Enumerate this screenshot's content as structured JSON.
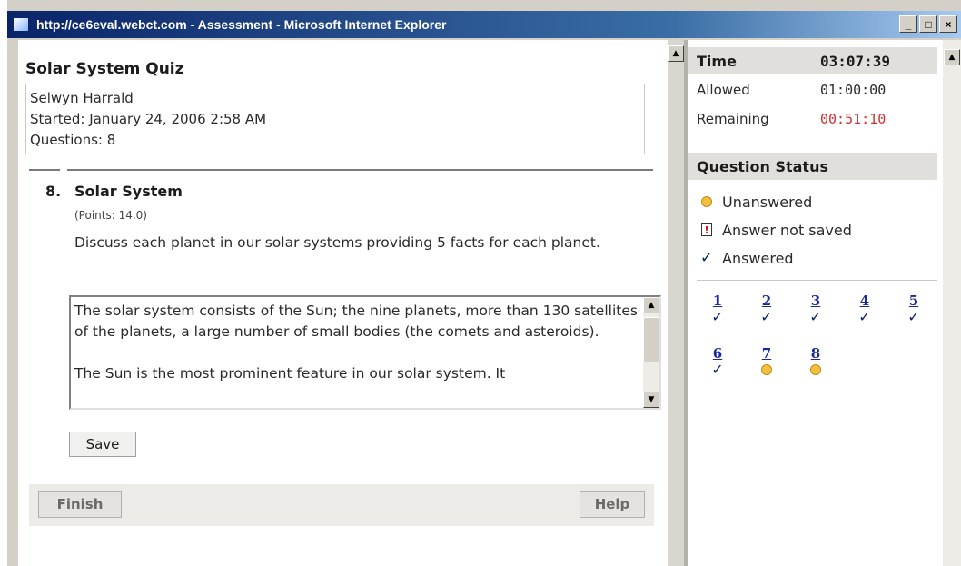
{
  "window": {
    "title": "http://ce6eval.webct.com - Assessment - Microsoft Internet Explorer",
    "buttons": {
      "minimize": "_",
      "maximize": "□",
      "close": "×"
    }
  },
  "quiz": {
    "title": "Solar System Quiz",
    "student": "Selwyn Harrald",
    "started": "Started: January 24, 2006 2:58 AM",
    "questions": "Questions: 8"
  },
  "question": {
    "number": "8.",
    "title": "Solar System",
    "points": "(Points: 14.0)",
    "text": "Discuss each planet in our solar systems providing 5 facts for each planet.",
    "answer": "The solar system consists of the Sun; the nine planets, more than 130 satellites of the planets, a large number of small bodies (the comets and asteroids).\n\nThe Sun is the most prominent feature in our solar system. It"
  },
  "actions": {
    "save": "Save",
    "finish": "Finish",
    "help": "Help"
  },
  "timer": {
    "label": "Time",
    "value": "03:07:39",
    "allowed_label": "Allowed",
    "allowed_value": "01:00:00",
    "remaining_label": "Remaining",
    "remaining_value": "00:51:10"
  },
  "status": {
    "header": "Question Status",
    "legend": {
      "unanswered": "Unanswered",
      "not_saved": "Answer not saved",
      "answered": "Answered"
    },
    "questions": [
      {
        "num": "1",
        "state": "answered"
      },
      {
        "num": "2",
        "state": "answered"
      },
      {
        "num": "3",
        "state": "answered"
      },
      {
        "num": "4",
        "state": "answered"
      },
      {
        "num": "5",
        "state": "answered"
      },
      {
        "num": "6",
        "state": "answered"
      },
      {
        "num": "7",
        "state": "unanswered"
      },
      {
        "num": "8",
        "state": "unanswered"
      }
    ]
  },
  "colors": {
    "remaining": "#d03030",
    "link": "#1a2a9a",
    "titlebar": "#0a246a"
  }
}
